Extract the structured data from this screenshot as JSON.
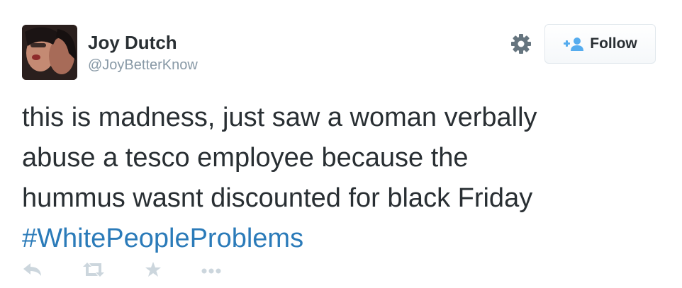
{
  "user": {
    "name": "Joy Dutch",
    "handle": "@JoyBetterKnow"
  },
  "follow_button": {
    "label": "Follow"
  },
  "tweet": {
    "lines": [
      "this is madness, just saw a woman verbally",
      "abuse a tesco employee because the",
      "hummus wasnt discounted for black Friday"
    ],
    "hashtag": "#WhitePeopleProblems"
  },
  "actions": [
    "reply-icon",
    "retweet-icon",
    "favorite-icon",
    "more-icon"
  ],
  "colors": {
    "text": "#292f33",
    "secondary": "#8899a6",
    "link": "#2b7bb9",
    "follow_icon": "#55acee",
    "action_icons": "#ccd6dd"
  }
}
